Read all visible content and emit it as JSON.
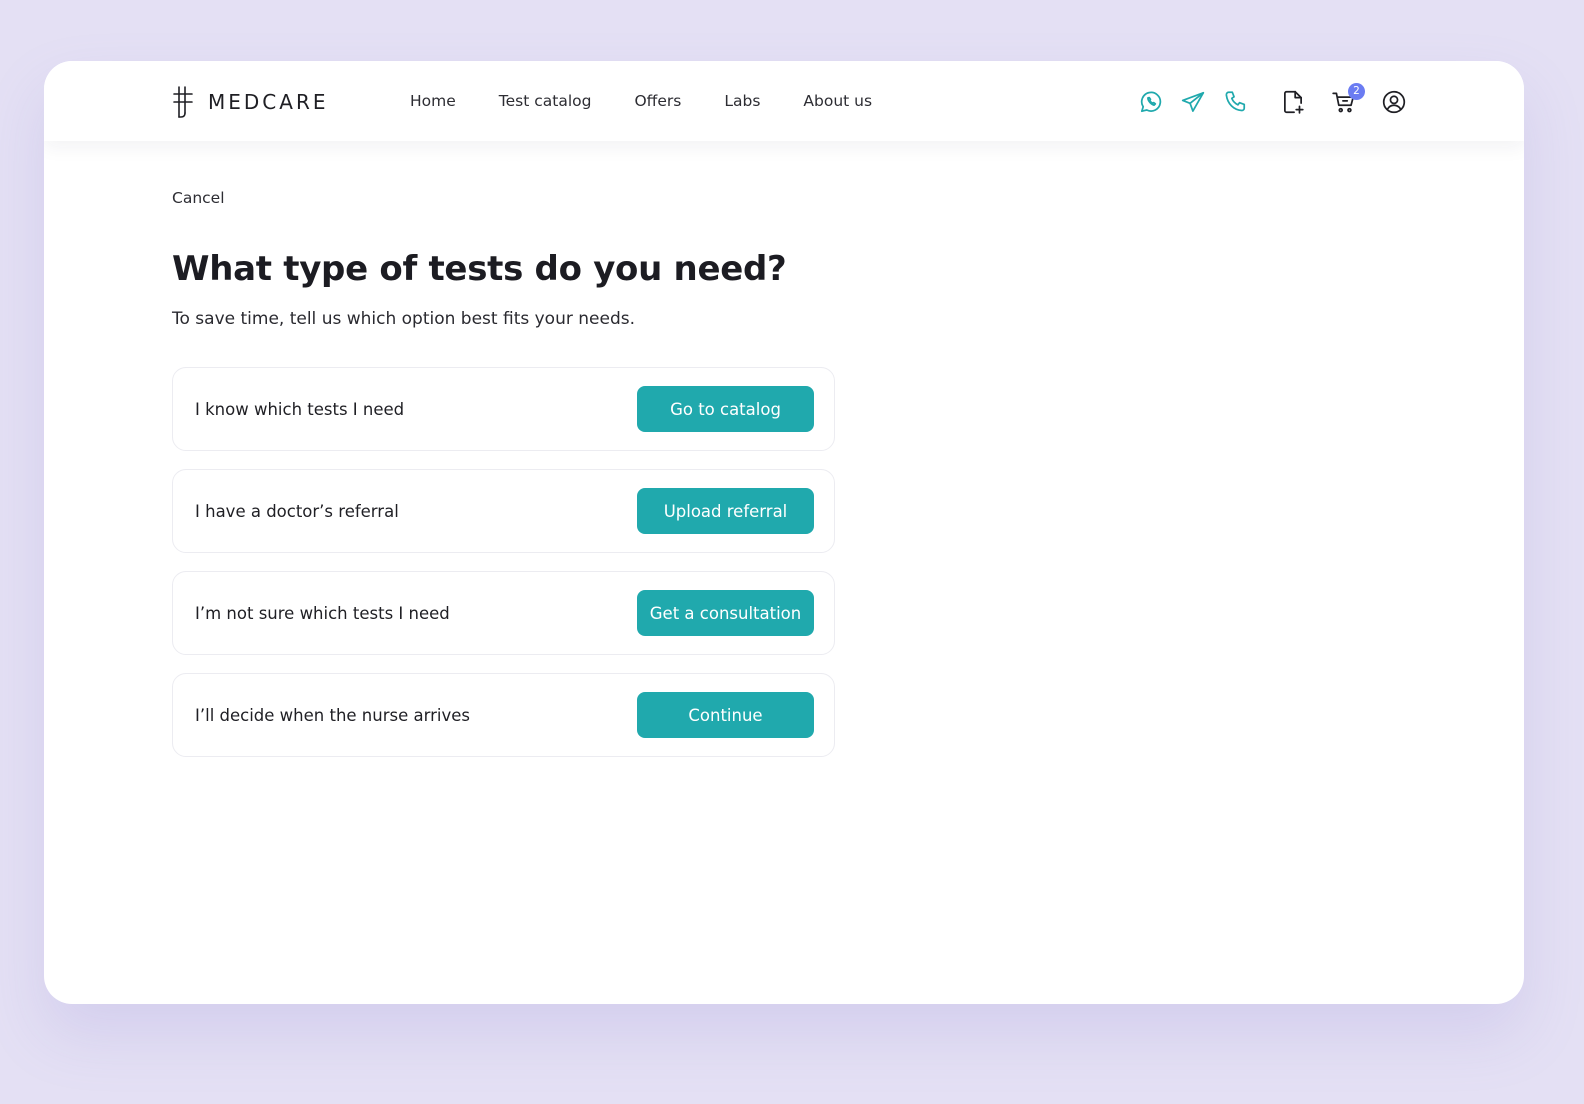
{
  "colors": {
    "background": "#e4e0f4",
    "accent": "#20a9ad",
    "badge": "#6b7cf2",
    "text": "#1f1f24"
  },
  "header": {
    "brand_name": "MEDCARE",
    "nav": [
      {
        "label": "Home"
      },
      {
        "label": "Test catalog"
      },
      {
        "label": "Offers"
      },
      {
        "label": "Labs"
      },
      {
        "label": "About us"
      }
    ],
    "icons": [
      "whatsapp-icon",
      "telegram-icon",
      "phone-icon",
      "add-document-icon",
      "cart-icon",
      "user-icon"
    ],
    "cart_count": "2"
  },
  "main": {
    "cancel_label": "Cancel",
    "title": "What type of tests do you need?",
    "subtitle": "To save time, tell us which option best fits your needs.",
    "options": [
      {
        "label": "I know which tests I need",
        "button": "Go to catalog"
      },
      {
        "label": "I have a doctor’s referral",
        "button": "Upload referral"
      },
      {
        "label": "I’m not sure which tests I need",
        "button": "Get a consultation"
      },
      {
        "label": "I’ll decide when the nurse arrives",
        "button": "Continue"
      }
    ]
  }
}
